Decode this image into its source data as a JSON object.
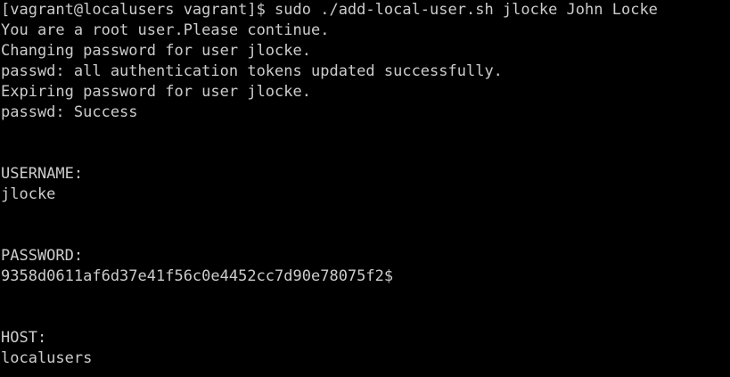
{
  "terminal": {
    "lines": [
      "[vagrant@localusers vagrant]$ sudo ./add-local-user.sh jlocke John Locke",
      "You are a root user.Please continue.",
      "Changing password for user jlocke.",
      "passwd: all authentication tokens updated successfully.",
      "Expiring password for user jlocke.",
      "passwd: Success",
      "",
      "",
      "USERNAME:",
      "jlocke",
      "",
      "",
      "PASSWORD:",
      "9358d0611af6d37e41f56c0e4452cc7d90e78075f2$",
      "",
      "",
      "HOST:",
      "localusers"
    ]
  },
  "colors": {
    "background": "#000000",
    "foreground": "#cccccc"
  }
}
